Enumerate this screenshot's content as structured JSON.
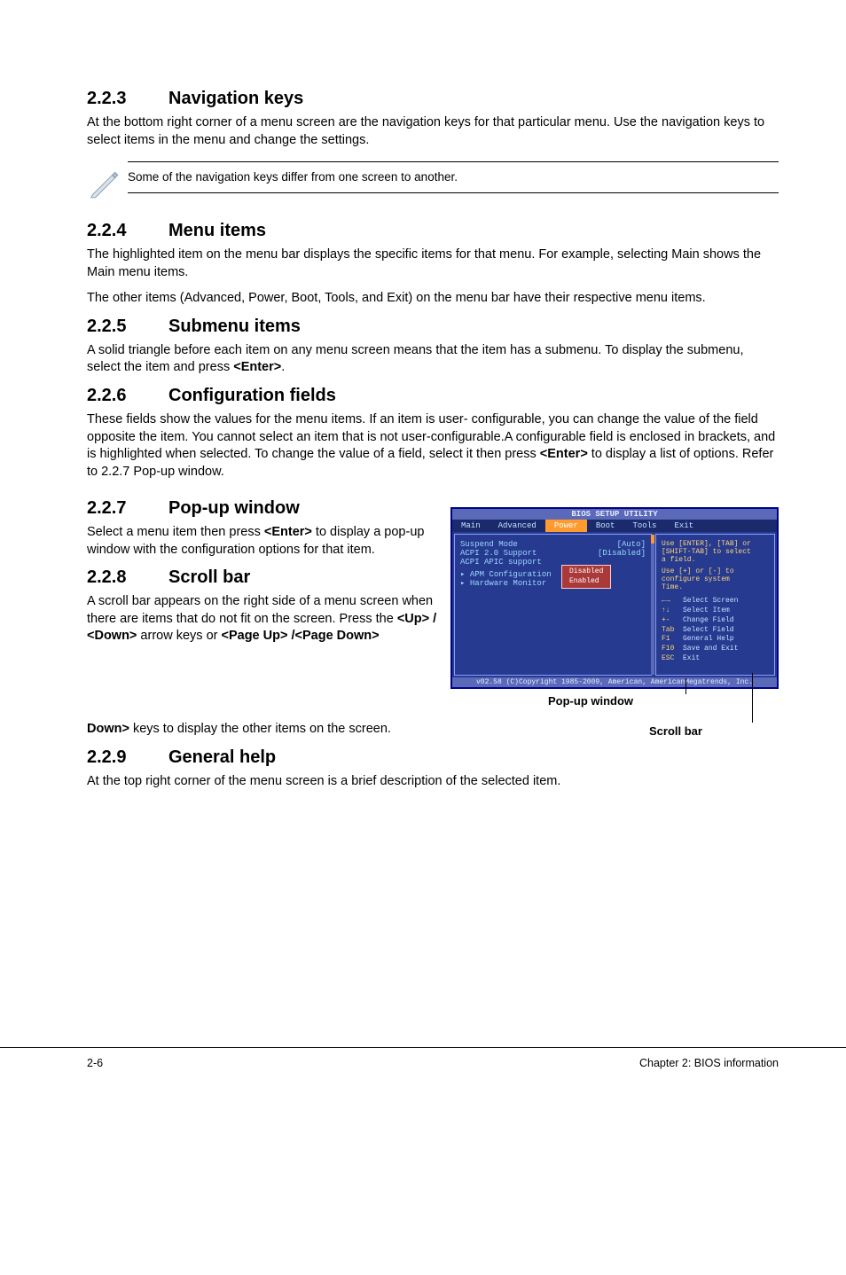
{
  "s223": {
    "title_num": "2.2.3",
    "title": "Navigation keys",
    "p1": "At the bottom right corner of a menu screen are the navigation keys for that particular menu. Use the navigation keys to select items in the menu and change the settings.",
    "note": "Some of the navigation keys differ from one screen to another."
  },
  "s224": {
    "title_num": "2.2.4",
    "title": "Menu items",
    "p1": "The highlighted item on the menu bar displays the specific items for that menu. For example, selecting Main shows the Main menu items.",
    "p2": "The other items (Advanced, Power, Boot, Tools, and Exit) on the menu bar have their respective menu items."
  },
  "s225": {
    "title_num": "2.2.5",
    "title": "Submenu items",
    "p1_a": "A solid triangle before each item on any menu screen means that the item has a submenu. To display the submenu, select the item and press ",
    "p1_b": "<Enter>",
    "p1_c": "."
  },
  "s226": {
    "title_num": "2.2.6",
    "title": "Configuration fields",
    "p1_a": "These fields show the values for the menu items. If an item is user- configurable, you can change the value of the field opposite the item. You cannot select an item that is not user-configurable.A configurable field is enclosed in brackets, and is highlighted when selected. To change the value of a field, select it then press ",
    "p1_b": "<Enter>",
    "p1_c": " to display a list of options. Refer to 2.2.7 Pop-up window."
  },
  "s227": {
    "title_num": "2.2.7",
    "title": "Pop-up window",
    "p1_a": "Select a menu item then press ",
    "p1_b": "<Enter>",
    "p1_c": " to display a pop-up window with the configuration options for that item."
  },
  "s228": {
    "title_num": "2.2.8",
    "title": "Scroll bar",
    "p1_a": "A scroll bar appears on the right side of a menu screen when there are items that do not fit on the screen. Press the ",
    "p1_b": "<Up> / <Down>",
    "p1_c": " arrow keys or ",
    "p1_d": "<Page Up> /<Page Down>",
    "p1_e": " keys to display the other items on the screen."
  },
  "s229": {
    "title_num": "2.2.9",
    "title": "General help",
    "p1": "At the top right corner of the menu screen is a brief description of the selected item."
  },
  "bios": {
    "titlebar": "BIOS SETUP UTILITY",
    "menus": {
      "main": "Main",
      "advanced": "Advanced",
      "power": "Power",
      "boot": "Boot",
      "tools": "Tools",
      "exit": "Exit"
    },
    "rows": {
      "r1_l": "Suspend Mode",
      "r1_v": "[Auto]",
      "r2_l": "ACPI 2.0 Support",
      "r2_v": "[Disabled]",
      "r3_l": "ACPI APIC support",
      "r4_l": "▸ APM Configuration",
      "r5_l": "▸ Hardware Monitor"
    },
    "popup": {
      "l1": "Disabled",
      "l2": "Enabled"
    },
    "help": {
      "h1": "Use [ENTER], [TAB] or",
      "h2": "[SHIFT-TAB] to select",
      "h3": "a field.",
      "h4": "Use [+] or [-] to",
      "h5": "configure system",
      "h6": "Time."
    },
    "keys": {
      "k1a": "←→",
      "k1b": "Select Screen",
      "k2a": "↑↓",
      "k2b": "Select Item",
      "k3a": "+-",
      "k3b": "Change Field",
      "k4a": "Tab",
      "k4b": "Select Field",
      "k5a": "F1",
      "k5b": "General Help",
      "k6a": "F10",
      "k6b": "Save and Exit",
      "k7a": "ESC",
      "k7b": "Exit"
    },
    "footer": "v02.58 (C)Copyright 1985-2009, American, AmericanMegatrends, Inc."
  },
  "callouts": {
    "popup": "Pop-up window",
    "scroll": "Scroll bar"
  },
  "footer": {
    "left": "2-6",
    "right": "Chapter 2: BIOS information"
  }
}
